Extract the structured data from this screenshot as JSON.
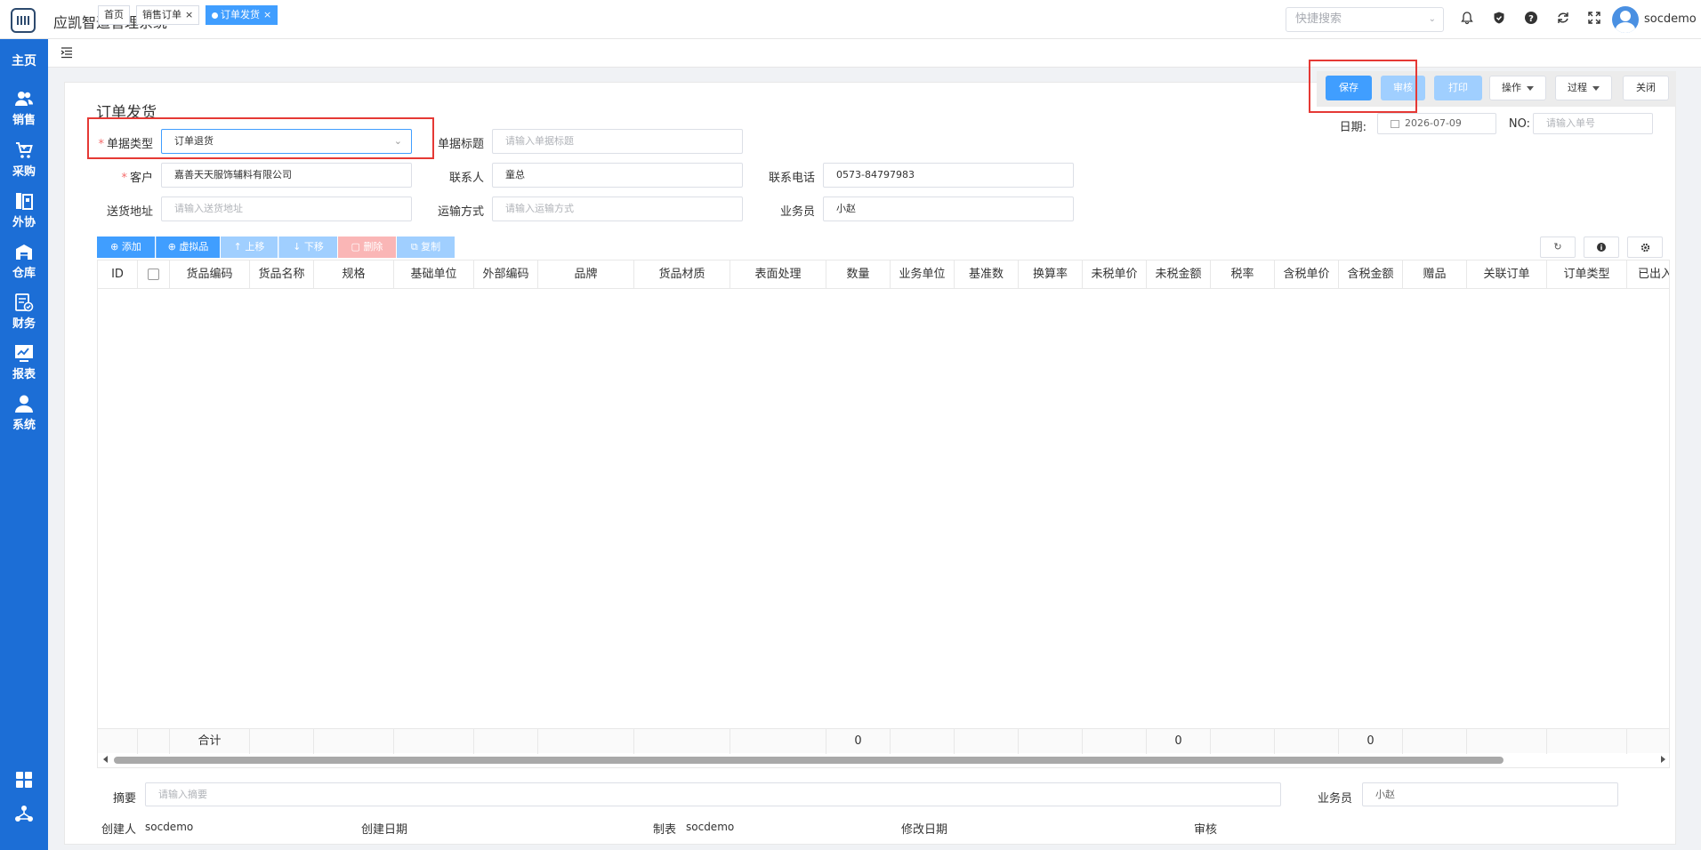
{
  "header": {
    "app_title": "应凯智造管理系统",
    "search_placeholder": "快捷搜索",
    "username": "socdemo"
  },
  "sidebar": {
    "home": "主页",
    "items": [
      {
        "label": "销售",
        "icon": "users-icon"
      },
      {
        "label": "采购",
        "icon": "cart-icon"
      },
      {
        "label": "外协",
        "icon": "outsource-icon"
      },
      {
        "label": "仓库",
        "icon": "warehouse-icon"
      },
      {
        "label": "财务",
        "icon": "finance-icon"
      },
      {
        "label": "报表",
        "icon": "chart-icon"
      },
      {
        "label": "系统",
        "icon": "user-icon"
      }
    ]
  },
  "tabs": [
    {
      "label": "首页",
      "active": false,
      "closable": false
    },
    {
      "label": "销售订单",
      "active": false,
      "closable": true
    },
    {
      "label": "订单发货",
      "active": true,
      "closable": true
    }
  ],
  "page": {
    "title": "订单发货"
  },
  "actions": {
    "save": "保存",
    "audit": "审核",
    "print": "打印",
    "operate": "操作",
    "process": "过程",
    "close": "关闭"
  },
  "form": {
    "doc_type_label": "单据类型",
    "doc_type_value": "订单退货",
    "doc_title_label": "单据标题",
    "doc_title_placeholder": "请输入单据标题",
    "date_label": "日期:",
    "date_value": "2026-07-09",
    "no_label": "NO:",
    "no_placeholder": "请输入单号",
    "customer_label": "客户",
    "customer_value": "嘉善天天服饰辅料有限公司",
    "contact_label": "联系人",
    "contact_value": "童总",
    "phone_label": "联系电话",
    "phone_value": "0573-84797983",
    "address_label": "送货地址",
    "address_placeholder": "请输入送货地址",
    "shipping_label": "运输方式",
    "shipping_placeholder": "请输入运输方式",
    "salesman_label": "业务员",
    "salesman_value": "小赵"
  },
  "grid_buttons": {
    "add": "添加",
    "virtual": "虚拟品",
    "up": "上移",
    "down": "下移",
    "delete": "删除",
    "copy": "复制"
  },
  "table": {
    "columns": [
      "ID",
      "",
      "货品编码",
      "货品名称",
      "规格",
      "基础单位",
      "外部编码",
      "品牌",
      "货品材质",
      "表面处理",
      "数量",
      "业务单位",
      "基准数",
      "换算率",
      "未税单价",
      "未税金额",
      "税率",
      "含税单价",
      "含税金额",
      "赠品",
      "关联订单",
      "订单类型",
      "已出入"
    ],
    "footer": {
      "label": "合计",
      "qty": "0",
      "untaxed_amount": "0",
      "taxed_amount": "0"
    }
  },
  "bottom": {
    "summary_label": "摘要",
    "summary_placeholder": "请输入摘要",
    "salesman_label": "业务员",
    "salesman_value": "小赵",
    "creator_label": "创建人",
    "creator_value": "socdemo",
    "created_date_label": "创建日期",
    "maker_label": "制表",
    "maker_value": "socdemo",
    "modified_date_label": "修改日期",
    "audit_label": "审核"
  }
}
